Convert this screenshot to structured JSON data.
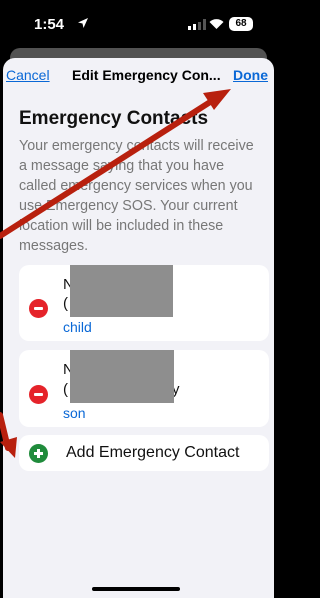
{
  "status_bar": {
    "time": "1:54",
    "battery": "68"
  },
  "nav": {
    "cancel": "Cancel",
    "title": "Edit Emergency Con...",
    "done": "Done"
  },
  "heading": "Emergency Contacts",
  "description": "Your emergency contacts will receive a message saying that you have called emergency services when you use Emergency SOS. Your current location will be included in these messages.",
  "contacts": [
    {
      "initial": "N",
      "paren": "(",
      "relation": "child"
    },
    {
      "initial": "N",
      "paren": "(",
      "trailing": "y",
      "relation": "son"
    }
  ],
  "add_contact": "Add Emergency Contact",
  "colors": {
    "link": "#0a68d6",
    "delete": "#e5232a",
    "add": "#1f8b3b",
    "annotation": "#b8200e"
  }
}
